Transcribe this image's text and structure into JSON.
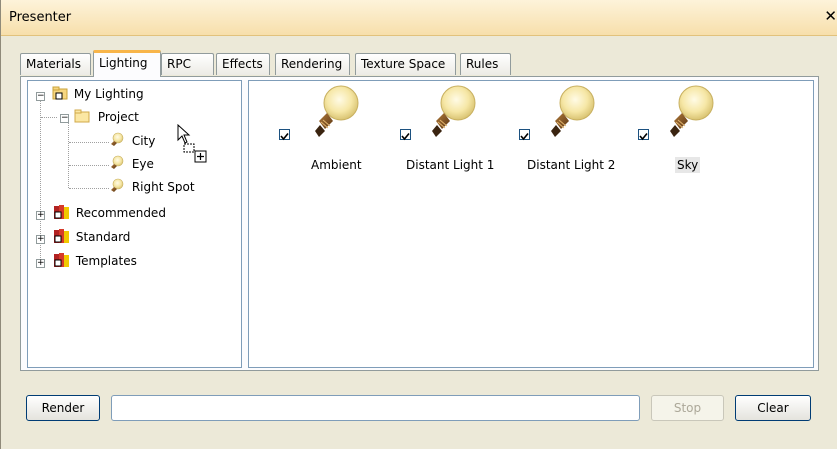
{
  "window": {
    "title": "Presenter"
  },
  "tabs": [
    {
      "label": "Materials",
      "active": false
    },
    {
      "label": "Lighting",
      "active": true
    },
    {
      "label": "RPC",
      "active": false
    },
    {
      "label": "Effects",
      "active": false
    },
    {
      "label": "Rendering",
      "active": false
    },
    {
      "label": "Texture Space",
      "active": false
    },
    {
      "label": "Rules",
      "active": false
    }
  ],
  "tree": {
    "root_label": "My Lighting",
    "project_label": "Project",
    "lights": [
      "City",
      "Eye",
      "Right Spot"
    ],
    "recommended_label": "Recommended",
    "standard_label": "Standard",
    "templates_label": "Templates"
  },
  "lights": [
    {
      "label": "Ambient",
      "checked": true,
      "selected": false
    },
    {
      "label": "Distant Light 1",
      "checked": true,
      "selected": false
    },
    {
      "label": "Distant Light 2",
      "checked": true,
      "selected": false
    },
    {
      "label": "Sky",
      "checked": true,
      "selected": true
    }
  ],
  "buttons": {
    "render": "Render",
    "stop": "Stop",
    "clear": "Clear"
  },
  "colors": {
    "tab_accent": "#f8b54a",
    "titlebar": "#f7dfab",
    "book_red": "#b22222"
  }
}
